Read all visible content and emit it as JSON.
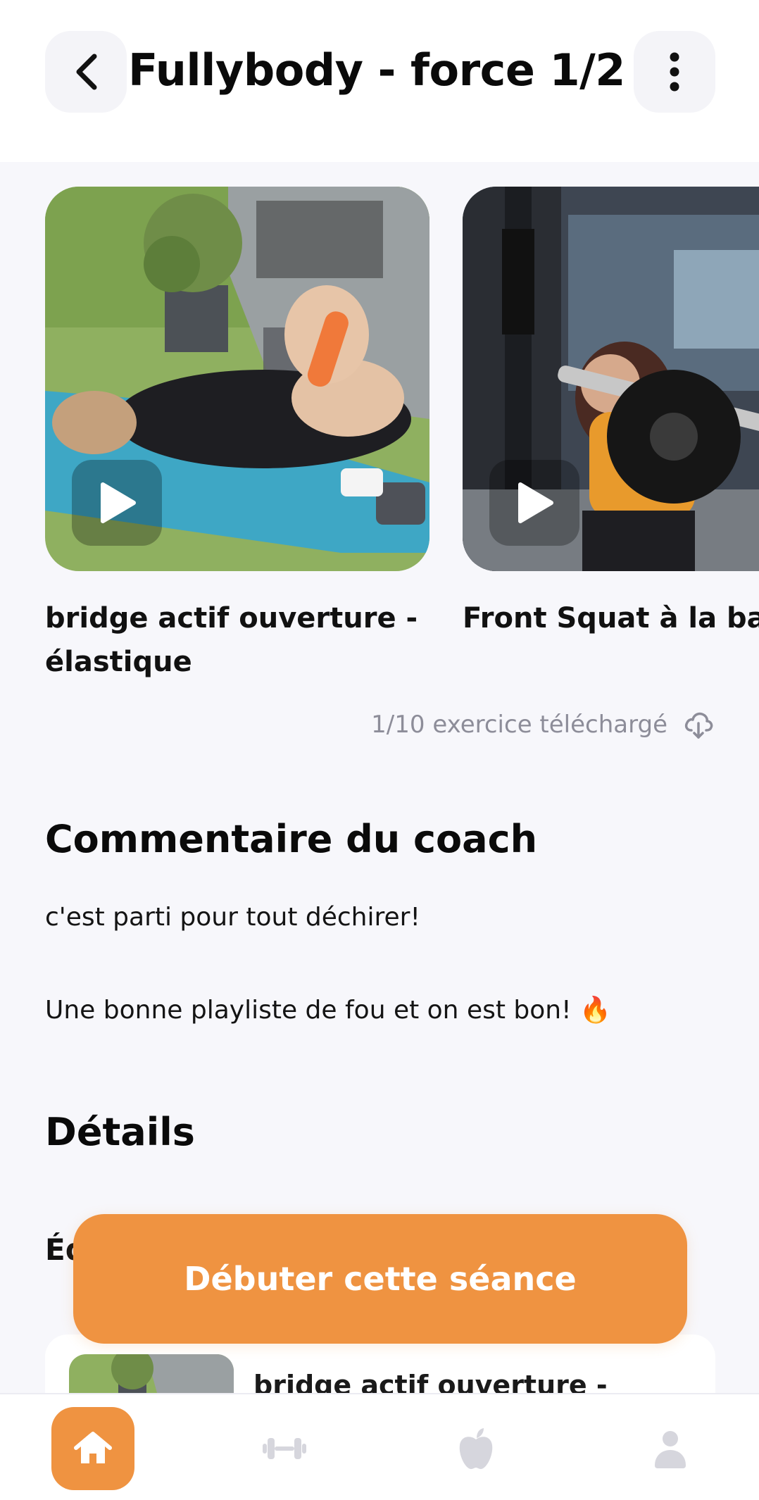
{
  "header": {
    "title": "Fullybody - force  1/2",
    "back_icon": "chevron-left-icon",
    "more_icon": "vertical-dots-icon"
  },
  "exercises": [
    {
      "title": "bridge actif ouverture - élastique",
      "title_line1": "bridge actif ouverture -",
      "title_line2": "élastique",
      "media": "video-thumbnail",
      "play_icon": "play-icon"
    },
    {
      "title": "Front Squat à la barre",
      "media": "video-thumbnail",
      "play_icon": "play-icon"
    }
  ],
  "download_status": {
    "text": "1/10 exercice téléchargé",
    "icon": "cloud-download-icon"
  },
  "coach": {
    "title": "Commentaire du coach",
    "line1": "c'est parti pour tout déchirer!",
    "line2": "Une bonne playliste de fou et on est bon! 🔥"
  },
  "details": {
    "title": "Détails",
    "equipment_label_visible": "Éq"
  },
  "preview": {
    "exercise_title": "bridge actif ouverture -"
  },
  "cta": {
    "label": "Débuter cette séance"
  },
  "bottom_nav": {
    "items": [
      {
        "name": "home",
        "icon": "home-icon",
        "active": true
      },
      {
        "name": "workout",
        "icon": "dumbbell-icon",
        "active": false
      },
      {
        "name": "nutrition",
        "icon": "apple-icon",
        "active": false
      },
      {
        "name": "profile",
        "icon": "user-icon",
        "active": false
      }
    ]
  },
  "colors": {
    "accent": "#ef9341",
    "background": "#f7f7fb",
    "muted_text": "#8d8d99",
    "inactive_icon": "#d6d6dd"
  }
}
